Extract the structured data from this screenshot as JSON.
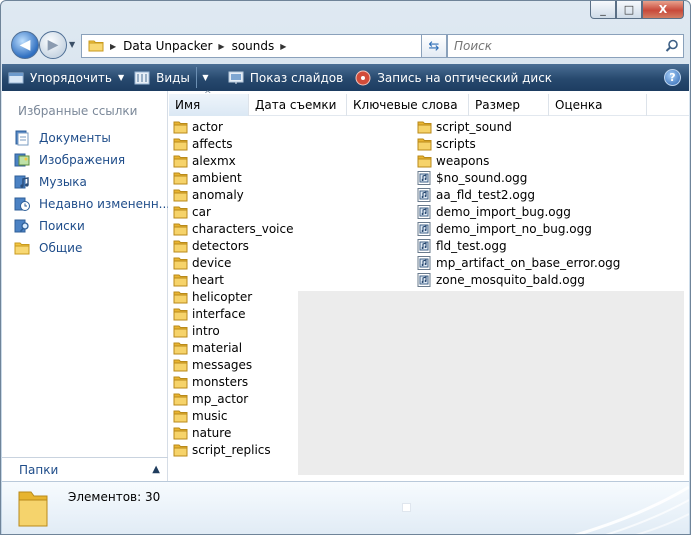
{
  "window": {
    "caption_buttons": [
      "_",
      "□",
      "X"
    ]
  },
  "address_bar": {
    "path": [
      "Data Unpacker",
      "sounds"
    ]
  },
  "search": {
    "placeholder": "Поиск"
  },
  "toolbar": {
    "organize": "Упорядочить",
    "views": "Виды",
    "slideshow": "Показ слайдов",
    "burn": "Запись на оптический диск",
    "help": "?"
  },
  "nav_pane": {
    "header": "Избранные ссылки",
    "items": [
      {
        "label": "Документы",
        "icon": "documents-icon"
      },
      {
        "label": "Изображения",
        "icon": "pictures-icon"
      },
      {
        "label": "Музыка",
        "icon": "music-icon"
      },
      {
        "label": "Недавно измененн...",
        "icon": "recent-icon"
      },
      {
        "label": "Поиски",
        "icon": "searches-icon"
      },
      {
        "label": "Общие",
        "icon": "public-folder-icon"
      }
    ],
    "folders_label": "Папки"
  },
  "columns": [
    "Имя",
    "Дата съемки",
    "Ключевые слова",
    "Размер",
    "Оценка"
  ],
  "files_col1": [
    "actor",
    "affects",
    "alexmx",
    "ambient",
    "anomaly",
    "car",
    "characters_voice",
    "detectors",
    "device",
    "heart",
    "helicopter",
    "interface",
    "intro",
    "material",
    "messages",
    "monsters",
    "mp_actor",
    "music",
    "nature",
    "script_replics"
  ],
  "files_col2": [
    {
      "name": "script_sound",
      "type": "folder"
    },
    {
      "name": "scripts",
      "type": "folder"
    },
    {
      "name": "weapons",
      "type": "folder"
    },
    {
      "name": "$no_sound.ogg",
      "type": "audio"
    },
    {
      "name": "aa_fld_test2.ogg",
      "type": "audio"
    },
    {
      "name": "demo_import_bug.ogg",
      "type": "audio"
    },
    {
      "name": "demo_import_no_bug.ogg",
      "type": "audio"
    },
    {
      "name": "fld_test.ogg",
      "type": "audio"
    },
    {
      "name": "mp_artifact_on_base_error.ogg",
      "type": "audio"
    },
    {
      "name": "zone_mosquito_bald.ogg",
      "type": "audio"
    }
  ],
  "details": {
    "count": "Элементов: 30"
  },
  "colors": {
    "toolbar": "#27496e",
    "link": "#1f4d8a",
    "folder": "#f3c543"
  }
}
